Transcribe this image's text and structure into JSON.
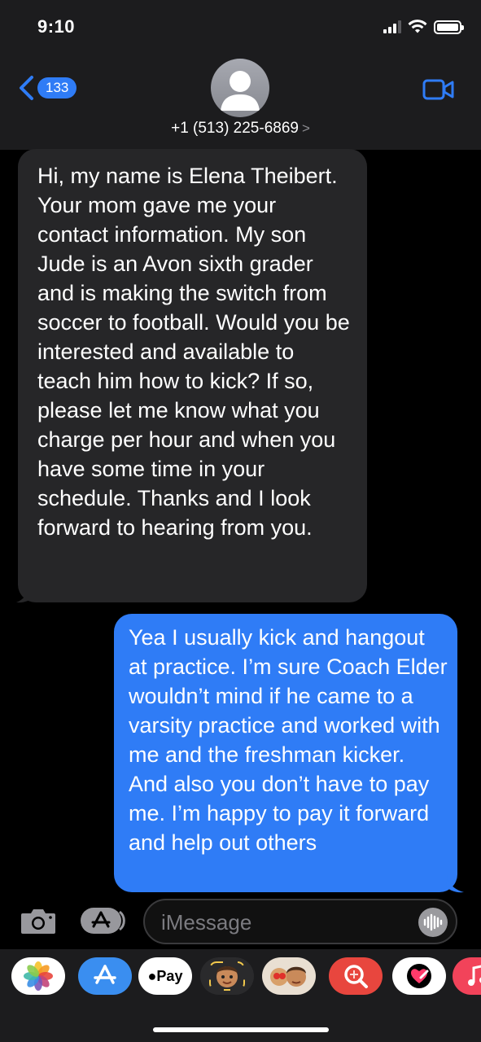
{
  "status": {
    "time": "9:10"
  },
  "nav": {
    "back_count": "133",
    "contact": "+1 (513) 225-6869",
    "contact_chevron": ">"
  },
  "messages": [
    {
      "from": "them",
      "text": "Hi, my name is Elena Theibert. Your mom gave me your contact information. My son Jude is an Avon sixth grader and is making the switch from soccer to football. Would you be interested and available to teach him how to kick? If so, please let me know what you charge per hour and when you have some time in your schedule. Thanks and I look forward to hearing from you."
    },
    {
      "from": "me",
      "text": "Yea I usually kick and hangout at practice. I’m sure Coach Elder wouldn’t mind if he came to a varsity practice and worked with me and the freshman kicker. And also you don’t have to pay me. I’m happy to pay it forward and help out others"
    }
  ],
  "input": {
    "placeholder": "iMessage",
    "value": ""
  },
  "apps": [
    {
      "name": "photos-icon"
    },
    {
      "name": "app-store-icon"
    },
    {
      "name": "apple-pay-icon",
      "label": "Pay"
    },
    {
      "name": "memoji-icon"
    },
    {
      "name": "memoji-stickers-icon"
    },
    {
      "name": "search-images-icon"
    },
    {
      "name": "digital-touch-icon"
    },
    {
      "name": "music-icon"
    }
  ],
  "colors": {
    "accent": "#2f7cf6",
    "incoming_bubble": "#262628",
    "header_bg": "#1c1c1e"
  }
}
